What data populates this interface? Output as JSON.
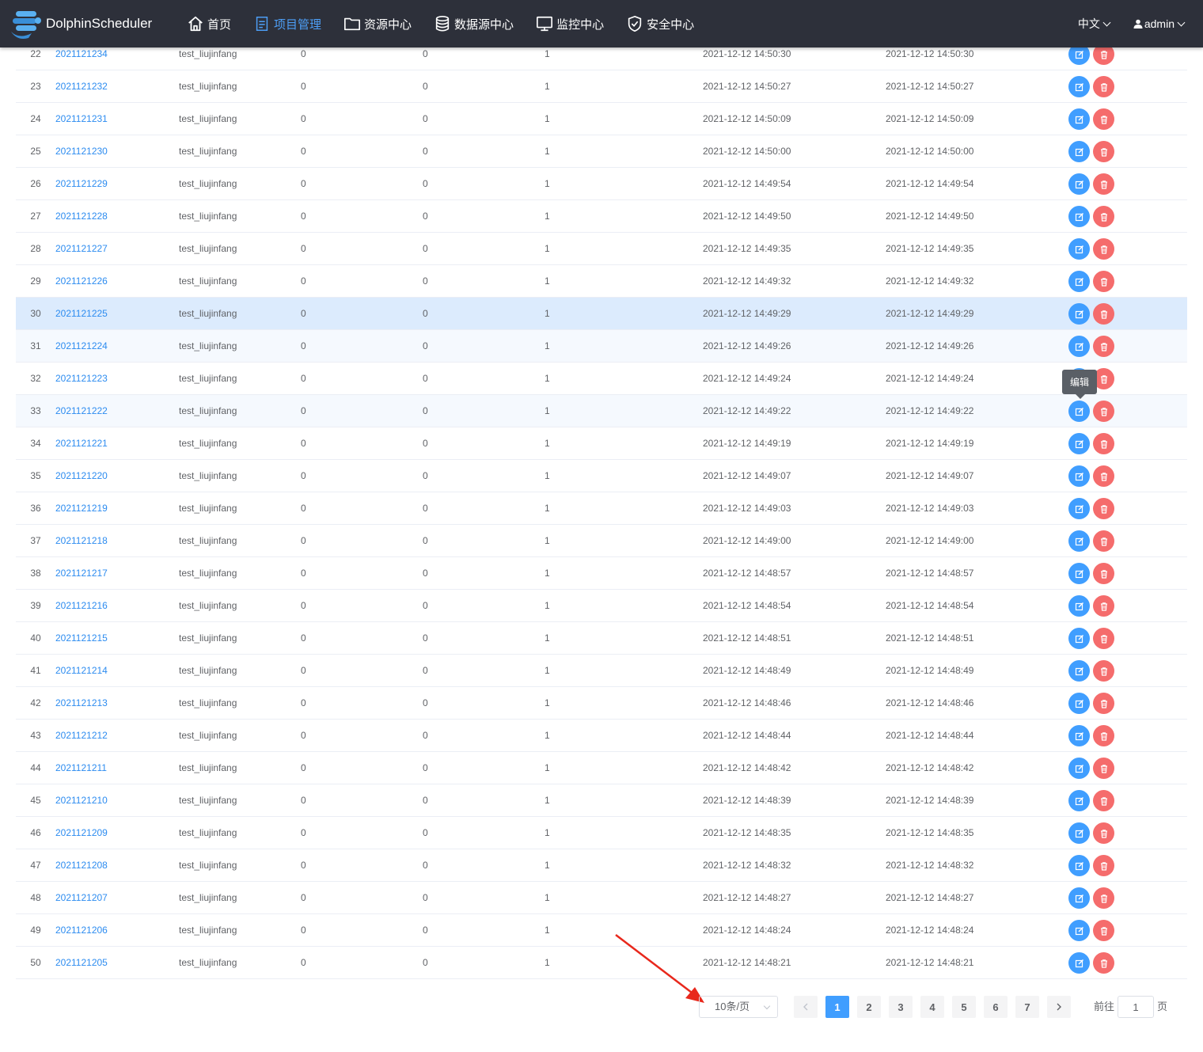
{
  "header": {
    "logo_text": "DolphinScheduler",
    "nav": [
      {
        "label": "首页",
        "icon": "home-icon",
        "active": false
      },
      {
        "label": "项目管理",
        "icon": "document-icon",
        "active": true
      },
      {
        "label": "资源中心",
        "icon": "folder-icon",
        "active": false
      },
      {
        "label": "数据源中心",
        "icon": "database-icon",
        "active": false
      },
      {
        "label": "监控中心",
        "icon": "monitor-icon",
        "active": false
      },
      {
        "label": "安全中心",
        "icon": "shield-icon",
        "active": false
      }
    ],
    "language": "中文",
    "user": "admin"
  },
  "table": {
    "rows": [
      {
        "idx": "22",
        "name": "2021121234",
        "owner": "test_liujinfang",
        "a": "0",
        "b": "0",
        "c": "1",
        "created": "2021-12-12 14:50:30",
        "updated": "2021-12-12 14:50:30"
      },
      {
        "idx": "23",
        "name": "2021121232",
        "owner": "test_liujinfang",
        "a": "0",
        "b": "0",
        "c": "1",
        "created": "2021-12-12 14:50:27",
        "updated": "2021-12-12 14:50:27"
      },
      {
        "idx": "24",
        "name": "2021121231",
        "owner": "test_liujinfang",
        "a": "0",
        "b": "0",
        "c": "1",
        "created": "2021-12-12 14:50:09",
        "updated": "2021-12-12 14:50:09"
      },
      {
        "idx": "25",
        "name": "2021121230",
        "owner": "test_liujinfang",
        "a": "0",
        "b": "0",
        "c": "1",
        "created": "2021-12-12 14:50:00",
        "updated": "2021-12-12 14:50:00"
      },
      {
        "idx": "26",
        "name": "2021121229",
        "owner": "test_liujinfang",
        "a": "0",
        "b": "0",
        "c": "1",
        "created": "2021-12-12 14:49:54",
        "updated": "2021-12-12 14:49:54"
      },
      {
        "idx": "27",
        "name": "2021121228",
        "owner": "test_liujinfang",
        "a": "0",
        "b": "0",
        "c": "1",
        "created": "2021-12-12 14:49:50",
        "updated": "2021-12-12 14:49:50"
      },
      {
        "idx": "28",
        "name": "2021121227",
        "owner": "test_liujinfang",
        "a": "0",
        "b": "0",
        "c": "1",
        "created": "2021-12-12 14:49:35",
        "updated": "2021-12-12 14:49:35"
      },
      {
        "idx": "29",
        "name": "2021121226",
        "owner": "test_liujinfang",
        "a": "0",
        "b": "0",
        "c": "1",
        "created": "2021-12-12 14:49:32",
        "updated": "2021-12-12 14:49:32"
      },
      {
        "idx": "30",
        "name": "2021121225",
        "owner": "test_liujinfang",
        "a": "0",
        "b": "0",
        "c": "1",
        "created": "2021-12-12 14:49:29",
        "updated": "2021-12-12 14:49:29"
      },
      {
        "idx": "31",
        "name": "2021121224",
        "owner": "test_liujinfang",
        "a": "0",
        "b": "0",
        "c": "1",
        "created": "2021-12-12 14:49:26",
        "updated": "2021-12-12 14:49:26"
      },
      {
        "idx": "32",
        "name": "2021121223",
        "owner": "test_liujinfang",
        "a": "0",
        "b": "0",
        "c": "1",
        "created": "2021-12-12 14:49:24",
        "updated": "2021-12-12 14:49:24"
      },
      {
        "idx": "33",
        "name": "2021121222",
        "owner": "test_liujinfang",
        "a": "0",
        "b": "0",
        "c": "1",
        "created": "2021-12-12 14:49:22",
        "updated": "2021-12-12 14:49:22"
      },
      {
        "idx": "34",
        "name": "2021121221",
        "owner": "test_liujinfang",
        "a": "0",
        "b": "0",
        "c": "1",
        "created": "2021-12-12 14:49:19",
        "updated": "2021-12-12 14:49:19"
      },
      {
        "idx": "35",
        "name": "2021121220",
        "owner": "test_liujinfang",
        "a": "0",
        "b": "0",
        "c": "1",
        "created": "2021-12-12 14:49:07",
        "updated": "2021-12-12 14:49:07"
      },
      {
        "idx": "36",
        "name": "2021121219",
        "owner": "test_liujinfang",
        "a": "0",
        "b": "0",
        "c": "1",
        "created": "2021-12-12 14:49:03",
        "updated": "2021-12-12 14:49:03"
      },
      {
        "idx": "37",
        "name": "2021121218",
        "owner": "test_liujinfang",
        "a": "0",
        "b": "0",
        "c": "1",
        "created": "2021-12-12 14:49:00",
        "updated": "2021-12-12 14:49:00"
      },
      {
        "idx": "38",
        "name": "2021121217",
        "owner": "test_liujinfang",
        "a": "0",
        "b": "0",
        "c": "1",
        "created": "2021-12-12 14:48:57",
        "updated": "2021-12-12 14:48:57"
      },
      {
        "idx": "39",
        "name": "2021121216",
        "owner": "test_liujinfang",
        "a": "0",
        "b": "0",
        "c": "1",
        "created": "2021-12-12 14:48:54",
        "updated": "2021-12-12 14:48:54"
      },
      {
        "idx": "40",
        "name": "2021121215",
        "owner": "test_liujinfang",
        "a": "0",
        "b": "0",
        "c": "1",
        "created": "2021-12-12 14:48:51",
        "updated": "2021-12-12 14:48:51"
      },
      {
        "idx": "41",
        "name": "2021121214",
        "owner": "test_liujinfang",
        "a": "0",
        "b": "0",
        "c": "1",
        "created": "2021-12-12 14:48:49",
        "updated": "2021-12-12 14:48:49"
      },
      {
        "idx": "42",
        "name": "2021121213",
        "owner": "test_liujinfang",
        "a": "0",
        "b": "0",
        "c": "1",
        "created": "2021-12-12 14:48:46",
        "updated": "2021-12-12 14:48:46"
      },
      {
        "idx": "43",
        "name": "2021121212",
        "owner": "test_liujinfang",
        "a": "0",
        "b": "0",
        "c": "1",
        "created": "2021-12-12 14:48:44",
        "updated": "2021-12-12 14:48:44"
      },
      {
        "idx": "44",
        "name": "2021121211",
        "owner": "test_liujinfang",
        "a": "0",
        "b": "0",
        "c": "1",
        "created": "2021-12-12 14:48:42",
        "updated": "2021-12-12 14:48:42"
      },
      {
        "idx": "45",
        "name": "2021121210",
        "owner": "test_liujinfang",
        "a": "0",
        "b": "0",
        "c": "1",
        "created": "2021-12-12 14:48:39",
        "updated": "2021-12-12 14:48:39"
      },
      {
        "idx": "46",
        "name": "2021121209",
        "owner": "test_liujinfang",
        "a": "0",
        "b": "0",
        "c": "1",
        "created": "2021-12-12 14:48:35",
        "updated": "2021-12-12 14:48:35"
      },
      {
        "idx": "47",
        "name": "2021121208",
        "owner": "test_liujinfang",
        "a": "0",
        "b": "0",
        "c": "1",
        "created": "2021-12-12 14:48:32",
        "updated": "2021-12-12 14:48:32"
      },
      {
        "idx": "48",
        "name": "2021121207",
        "owner": "test_liujinfang",
        "a": "0",
        "b": "0",
        "c": "1",
        "created": "2021-12-12 14:48:27",
        "updated": "2021-12-12 14:48:27"
      },
      {
        "idx": "49",
        "name": "2021121206",
        "owner": "test_liujinfang",
        "a": "0",
        "b": "0",
        "c": "1",
        "created": "2021-12-12 14:48:24",
        "updated": "2021-12-12 14:48:24"
      },
      {
        "idx": "50",
        "name": "2021121205",
        "owner": "test_liujinfang",
        "a": "0",
        "b": "0",
        "c": "1",
        "created": "2021-12-12 14:48:21",
        "updated": "2021-12-12 14:48:21"
      }
    ],
    "hover_row_idx": "30",
    "tooltip_text": "编辑"
  },
  "pagination": {
    "page_size": "10条/页",
    "pages": [
      "1",
      "2",
      "3",
      "4",
      "5",
      "6",
      "7"
    ],
    "current_page": "1",
    "goto_label": "前往",
    "goto_value": "1",
    "page_unit": "页"
  },
  "colors": {
    "header_bg": "#2d303a",
    "active_nav": "#4d9ff7",
    "link": "#2d8cf0",
    "edit_button": "#409eff",
    "delete_button": "#f56c6c",
    "annotation_arrow": "#e8281c"
  }
}
